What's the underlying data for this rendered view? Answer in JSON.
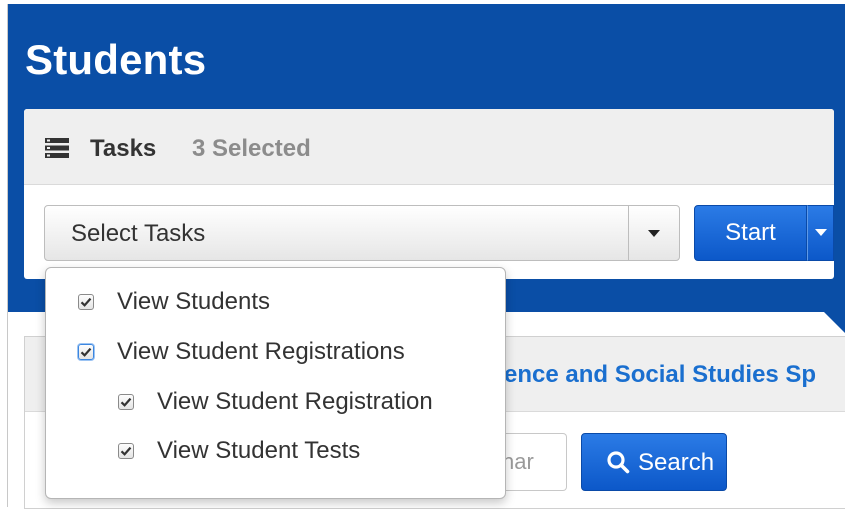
{
  "page": {
    "title": "Students"
  },
  "tasks": {
    "title": "Tasks",
    "selected_count": "3 Selected",
    "select_placeholder": "Select Tasks",
    "start_label": "Start",
    "options": [
      {
        "label": "View Students",
        "checked": true
      },
      {
        "label": "View Student Registrations",
        "checked": true
      },
      {
        "label": "View Student Registration",
        "checked": true
      },
      {
        "label": "View Student Tests",
        "checked": true
      }
    ]
  },
  "lower_panel": {
    "partial_title": "ence and Social Studies Sp",
    "search_placeholder": "har",
    "search_label": "Search"
  },
  "icons": {
    "tasks": "list-icon",
    "search": "magnifier-icon",
    "dropdown_caret": "chevron-down-icon",
    "start_caret": "chevron-down-icon",
    "checkbox": "checkmark-icon"
  },
  "colors": {
    "banner": "#0a4ea6",
    "primary_button": "#1466d8",
    "link": "#1a6fcf",
    "panel_header": "#efefef"
  }
}
